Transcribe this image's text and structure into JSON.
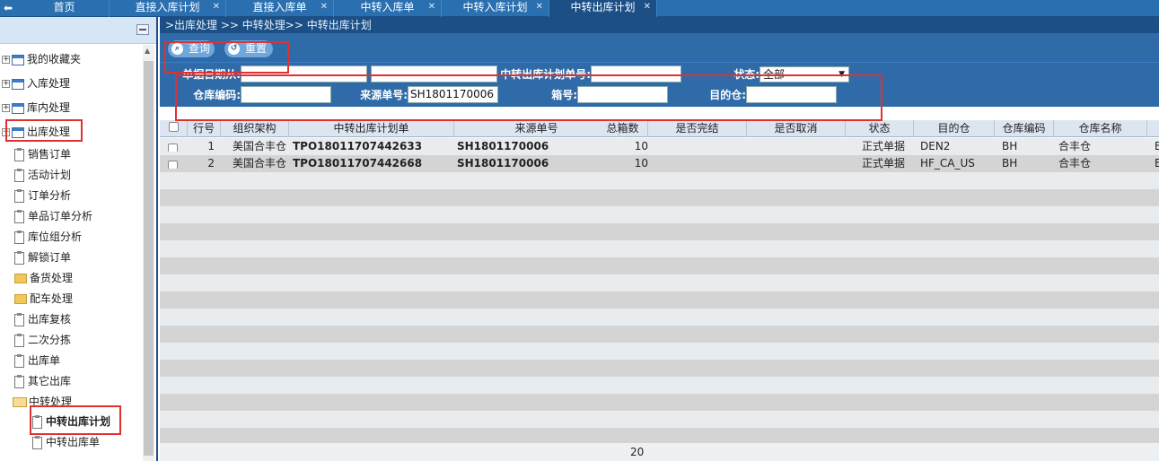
{
  "tabs": [
    {
      "label": "首页",
      "closable": false
    },
    {
      "label": "直接入库计划",
      "closable": true
    },
    {
      "label": "直接入库单",
      "closable": true
    },
    {
      "label": "中转入库单",
      "closable": true
    },
    {
      "label": "中转入库计划",
      "closable": true
    },
    {
      "label": "中转出库计划",
      "closable": true,
      "active": true
    }
  ],
  "sidebar": {
    "items": [
      {
        "label": "我的收藏夹",
        "icon": "window-icon"
      },
      {
        "label": "入库处理",
        "icon": "window-icon"
      },
      {
        "label": "库内处理",
        "icon": "window-icon"
      },
      {
        "label": "出库处理",
        "icon": "window-icon"
      },
      {
        "label": "销售订单",
        "icon": "clipboard-icon"
      },
      {
        "label": "活动计划",
        "icon": "clipboard-icon"
      },
      {
        "label": "订单分析",
        "icon": "clipboard-icon"
      },
      {
        "label": "单品订单分析",
        "icon": "clipboard-icon"
      },
      {
        "label": "库位组分析",
        "icon": "clipboard-icon"
      },
      {
        "label": "解锁订单",
        "icon": "clipboard-icon"
      },
      {
        "label": "备货处理",
        "icon": "folder-icon"
      },
      {
        "label": "配车处理",
        "icon": "folder-icon"
      },
      {
        "label": "出库复核",
        "icon": "clipboard-icon"
      },
      {
        "label": "二次分拣",
        "icon": "clipboard-icon"
      },
      {
        "label": "出库单",
        "icon": "clipboard-icon"
      },
      {
        "label": "其它出库",
        "icon": "clipboard-icon"
      },
      {
        "label": "中转处理",
        "icon": "folder-open-icon"
      },
      {
        "label": "中转出库计划",
        "icon": "clipboard-icon"
      },
      {
        "label": "中转出库单",
        "icon": "clipboard-icon"
      }
    ]
  },
  "breadcrumb": ">出库处理 >> 中转处理>> 中转出库计划",
  "toolbar": {
    "query_label": "查询",
    "reset_label": "重置"
  },
  "filters": {
    "date_from_label": "单据日期从:",
    "date_from_value": "",
    "date_to_value": "",
    "plan_no_label": "中转出库计划单号:",
    "plan_no_value": "",
    "status_label": "状态:",
    "status_value": "全部",
    "wh_code_label": "仓库编码:",
    "wh_code_value": "",
    "source_no_label": "来源单号:",
    "source_no_value": "SH1801170006",
    "box_no_label": "箱号:",
    "box_no_value": "",
    "dest_label": "目的仓:",
    "dest_value": ""
  },
  "grid": {
    "columns": [
      "行号",
      "组织架构",
      "中转出库计划单",
      "来源单号",
      "总箱数",
      "是否完结",
      "是否取消",
      "状态",
      "目的仓",
      "仓库编码",
      "仓库名称"
    ],
    "rows": [
      {
        "line": "1",
        "org": "美国合丰仓",
        "plan": "TPO18011707442633",
        "source": "SH1801170006",
        "boxes": "10",
        "done": "",
        "cancel": "",
        "status": "正式单据",
        "dest": "DEN2",
        "wh_code": "BH",
        "wh_name": "合丰仓",
        "extra": "E"
      },
      {
        "line": "2",
        "org": "美国合丰仓",
        "plan": "TPO18011707442668",
        "source": "SH1801170006",
        "boxes": "10",
        "done": "",
        "cancel": "",
        "status": "正式单据",
        "dest": "HF_CA_US",
        "wh_code": "BH",
        "wh_name": "合丰仓",
        "extra": "E"
      }
    ],
    "page_size": "20"
  }
}
